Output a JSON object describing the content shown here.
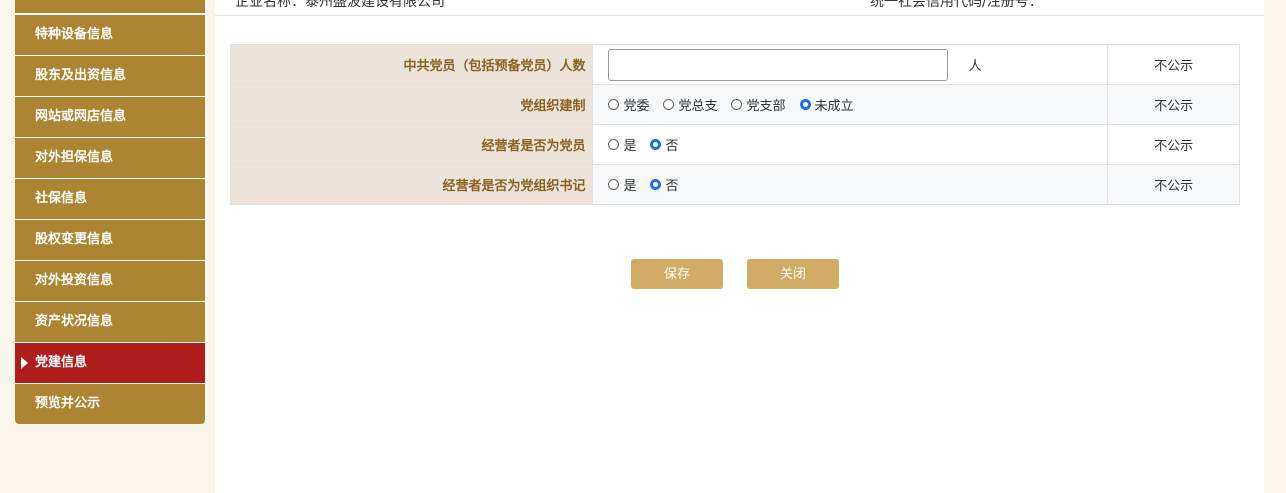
{
  "header": {
    "company_label": "企业名称：泰州盛波建设有限公司",
    "credit_label": "统一社会信用代码/注册号："
  },
  "sidebar": {
    "items": [
      {
        "label": "",
        "active": false
      },
      {
        "label": "特种设备信息",
        "active": false
      },
      {
        "label": "股东及出资信息",
        "active": false
      },
      {
        "label": "网站或网店信息",
        "active": false
      },
      {
        "label": "对外担保信息",
        "active": false
      },
      {
        "label": "社保信息",
        "active": false
      },
      {
        "label": "股权变更信息",
        "active": false
      },
      {
        "label": "对外投资信息",
        "active": false
      },
      {
        "label": "资产状况信息",
        "active": false
      },
      {
        "label": "党建信息",
        "active": true
      },
      {
        "label": "预览并公示",
        "active": false
      }
    ]
  },
  "form": {
    "rows": [
      {
        "label": "中共党员（包括预备党员）人数",
        "type": "number",
        "value": "",
        "unit": "人",
        "public": "不公示"
      },
      {
        "label": "党组织建制",
        "type": "radio",
        "options": [
          "党委",
          "党总支",
          "党支部",
          "未成立"
        ],
        "selected": "未成立",
        "public": "不公示"
      },
      {
        "label": "经营者是否为党员",
        "type": "radio",
        "options": [
          "是",
          "否"
        ],
        "selected": "否",
        "public": "不公示"
      },
      {
        "label": "经营者是否为党组织书记",
        "type": "radio",
        "options": [
          "是",
          "否"
        ],
        "selected": "否",
        "public": "不公示"
      }
    ]
  },
  "buttons": {
    "save_label": "保存",
    "close_label": "关闭"
  },
  "colors": {
    "sidebar_item": "#ad8431",
    "sidebar_active": "#b01c1c",
    "label_bg": "#ece3db",
    "label_text": "#8c6320",
    "button": "#d2ac64",
    "radio_checked": "#1a73e8"
  }
}
